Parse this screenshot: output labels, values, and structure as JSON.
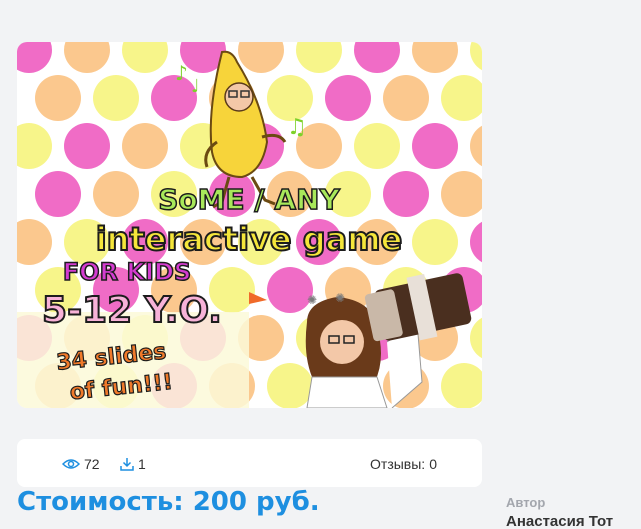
{
  "product": {
    "image_alt": "Interactive game cover",
    "cover": {
      "line1": "SoME / ANY",
      "line2": "interactive game",
      "line3": "FOR KIDS",
      "line4": "5-12 Y.O.",
      "line5": "34 slides",
      "line6": "of fun!!!"
    }
  },
  "stats": {
    "views": "72",
    "downloads": "1",
    "reviews_label": "Отзывы:",
    "reviews_count": "0"
  },
  "price": {
    "text": "Стоимость: 200 руб."
  },
  "author": {
    "label": "Автор",
    "name": "Анастасия Тот"
  },
  "colors": {
    "accent": "#1e8fe0",
    "dot_pink": "#f06cc6",
    "dot_peach": "#fbc88e",
    "dot_yellow": "#f7f58a"
  },
  "icons": {
    "views": "eye-icon",
    "downloads": "download-icon"
  }
}
